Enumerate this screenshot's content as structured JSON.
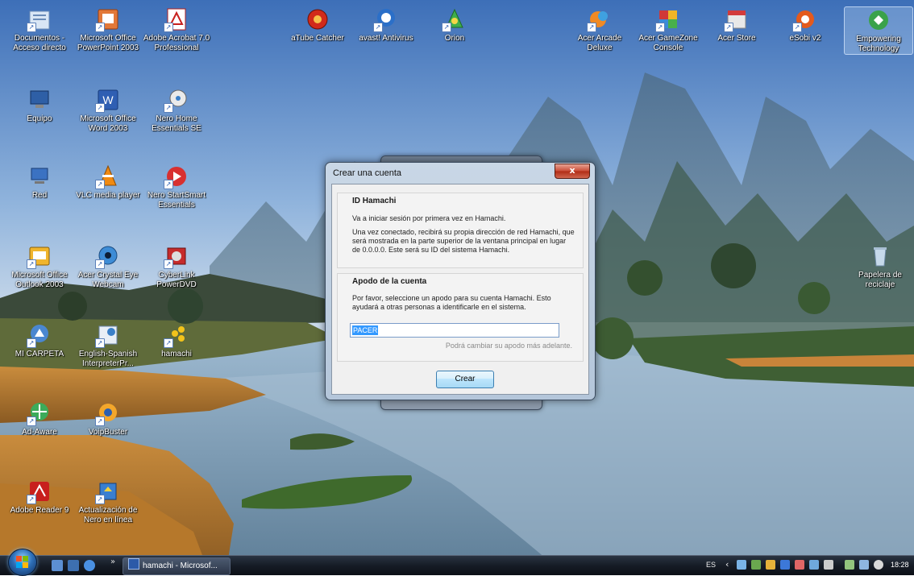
{
  "desktop": {
    "icons": [
      {
        "label": "Documentos - Acceso directo"
      },
      {
        "label": "Microsoft Office PowerPoint 2003"
      },
      {
        "label": "Adobe Acrobat 7.0 Professional"
      },
      {
        "label": "aTube Catcher"
      },
      {
        "label": "avast! Antivirus"
      },
      {
        "label": "Orion"
      },
      {
        "label": "Acer Arcade Deluxe"
      },
      {
        "label": "Acer GameZone Console"
      },
      {
        "label": "Acer Store"
      },
      {
        "label": "eSobi v2"
      },
      {
        "label": "Empowering Technology"
      },
      {
        "label": "Equipo"
      },
      {
        "label": "Microsoft Office Word 2003"
      },
      {
        "label": "Nero Home Essentials SE"
      },
      {
        "label": "Red"
      },
      {
        "label": "VLC media player"
      },
      {
        "label": "Nero StartSmart Essentials"
      },
      {
        "label": "Microsoft Office Outlook 2003"
      },
      {
        "label": "Acer Crystal Eye Webcam"
      },
      {
        "label": "CyberLink PowerDVD"
      },
      {
        "label": "Papelera de reciclaje"
      },
      {
        "label": "MI CARPETA"
      },
      {
        "label": "English-Spanish InterpreterPr..."
      },
      {
        "label": "hamachi"
      },
      {
        "label": "Ad-Aware"
      },
      {
        "label": "VoipBuster"
      },
      {
        "label": "Adobe Reader 9"
      },
      {
        "label": "Actualización de Nero en línea"
      }
    ]
  },
  "dialog": {
    "title": "Crear una cuenta",
    "close_label": "x",
    "id_section": {
      "heading": "ID Hamachi",
      "para1": "Va a iniciar sesión por primera vez en Hamachi.",
      "para2": "Una vez conectado, recibirá su propia dirección de red Hamachi, que será mostrada en la parte superior de la ventana principal en lugar de 0.0.0.0. Este será su ID del sistema Hamachi."
    },
    "nick_section": {
      "heading": "Apodo de la cuenta",
      "para": "Por favor, seleccione un apodo para su cuenta Hamachi. Esto ayudará a otras personas a identificarle en el sistema.",
      "nickname_value": "PACER",
      "hint": "Podrá cambiar su apodo más adelante."
    },
    "create_button": "Crear"
  },
  "taskbar": {
    "quicklaunch_chevron": "»",
    "task_button": "hamachi - Microsof...",
    "language": "ES",
    "tray_arrow": "‹",
    "clock": "18:28"
  }
}
